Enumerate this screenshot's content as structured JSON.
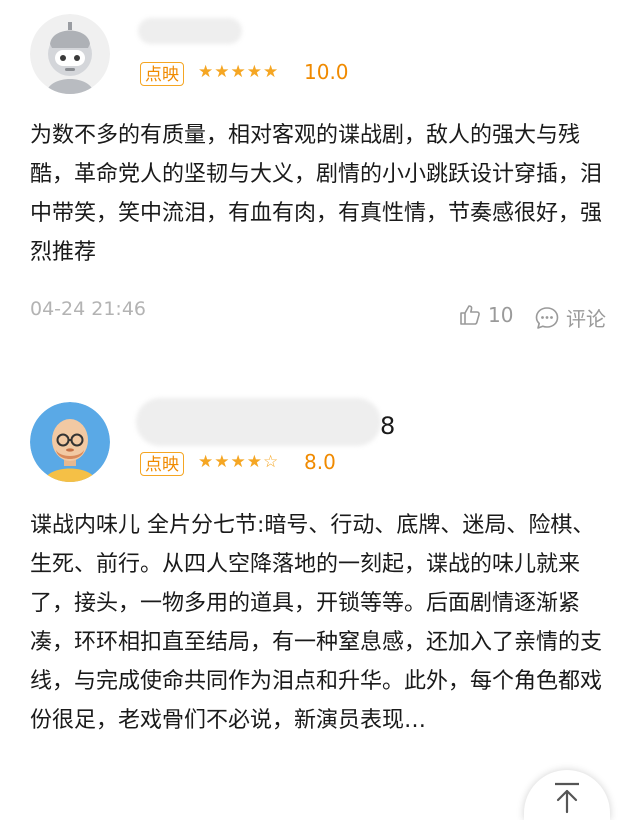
{
  "reviews": [
    {
      "username_suffix": "",
      "badge": "点映",
      "stars": "★★★★★",
      "score": "10.0",
      "text": "为数不多的有质量，相对客观的谍战剧，敌人的强大与残酷，革命党人的坚韧与大义，剧情的小小跳跃设计穿插，泪中带笑，笑中流泪，有血有肉，有真性情，节奏感很好，强烈推荐",
      "timestamp": "04-24 21:46",
      "like_count": "10",
      "comment_label": "评论"
    },
    {
      "username_suffix": "8",
      "badge": "点映",
      "stars": "★★★★☆",
      "score": "8.0",
      "text": "谍战内味儿 全片分七节:暗号、行动、底牌、迷局、险棋、生死、前行。从四人空降落地的一刻起，谍战的味儿就来了，接头，一物多用的道具，开锁等等。后面剧情逐渐紧凑，环环相扣直至结局，有一种窒息感，还加入了亲情的支线，与完成使命共同作为泪点和升华。此外，每个角色都戏份很足，老戏骨们不必说，新演员表现…"
    }
  ],
  "colors": {
    "accent": "#f08a00",
    "star": "#f5a623",
    "meta": "#b3b3b3"
  },
  "icons": {
    "like": "thumb-up-icon",
    "comment": "comment-bubble-icon",
    "scroll_top": "arrow-up-icon"
  }
}
